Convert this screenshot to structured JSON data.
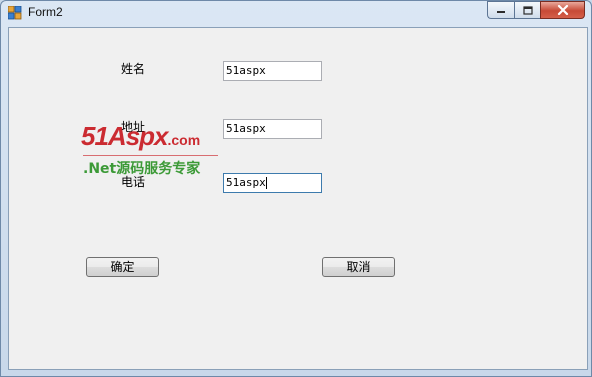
{
  "window": {
    "title": "Form2",
    "app_icon": "winforms-app-icon",
    "controls": {
      "minimize_icon": "minimize-icon",
      "maximize_icon": "maximize-icon",
      "close_icon": "close-icon"
    }
  },
  "form": {
    "name_label": "姓名",
    "name_value": "51aspx",
    "address_label": "地址",
    "address_value": "51aspx",
    "phone_label": "电话",
    "phone_value": "51aspx",
    "ok_button": "确定",
    "cancel_button": "取消"
  },
  "watermark": {
    "logo": "51Aspx",
    "logo_suffix": ".com",
    "tagline": ".Net源码服务专家"
  },
  "colors": {
    "watermark_red": "#c8161d",
    "watermark_green": "#3c9a37",
    "close_button_red": "#c74a36"
  }
}
